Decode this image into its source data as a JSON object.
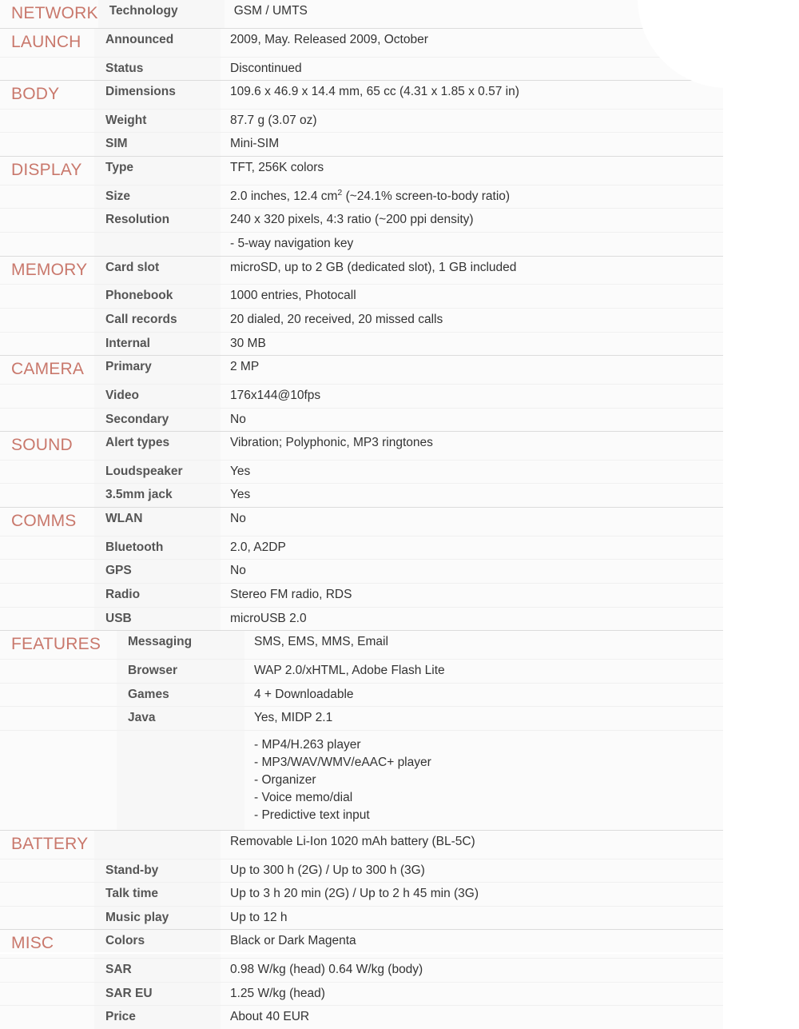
{
  "document": {
    "kind": "phone-specification-table",
    "section_header_color": "#c9786c",
    "label_color": "#555555",
    "value_color": "#333333",
    "row_background": "#fbfbfb",
    "label_background": "#f7f7f7",
    "divider_color": "#f0f0f0",
    "section_divider_color": "#dcdcdc"
  },
  "sections": [
    {
      "name": "NETWORK",
      "rows": [
        {
          "label": "Technology",
          "value": "GSM / UMTS"
        }
      ]
    },
    {
      "name": "LAUNCH",
      "rows": [
        {
          "label": "Announced",
          "value": "2009, May. Released 2009, October"
        },
        {
          "label": "Status",
          "value": "Discontinued"
        }
      ]
    },
    {
      "name": "BODY",
      "rows": [
        {
          "label": "Dimensions",
          "value": "109.6 x 46.9 x 14.4 mm, 65 cc (4.31 x 1.85 x 0.57 in)"
        },
        {
          "label": "Weight",
          "value": "87.7 g (3.07 oz)"
        },
        {
          "label": "SIM",
          "value": "Mini-SIM"
        }
      ]
    },
    {
      "name": "DISPLAY",
      "rows": [
        {
          "label": "Type",
          "value": "TFT, 256K colors"
        },
        {
          "label": "Size",
          "value": "2.0 inches, 12.4 cm2 (~24.1% screen-to-body ratio)",
          "value_html": "2.0 inches, 12.4 cm<sup>2</sup> (~24.1% screen-to-body ratio)"
        },
        {
          "label": "Resolution",
          "value": "240 x 320 pixels, 4:3 ratio (~200 ppi density)"
        },
        {
          "label": "",
          "value": "- 5-way navigation key"
        }
      ]
    },
    {
      "name": "MEMORY",
      "rows": [
        {
          "label": "Card slot",
          "value": "microSD, up to 2 GB (dedicated slot), 1 GB included"
        },
        {
          "label": "Phonebook",
          "value": "1000 entries, Photocall"
        },
        {
          "label": "Call records",
          "value": "20 dialed, 20 received, 20 missed calls"
        },
        {
          "label": "Internal",
          "value": "30 MB"
        }
      ]
    },
    {
      "name": "CAMERA",
      "rows": [
        {
          "label": "Primary",
          "value": "2 MP"
        },
        {
          "label": "Video",
          "value": "176x144@10fps"
        },
        {
          "label": "Secondary",
          "value": "No"
        }
      ]
    },
    {
      "name": "SOUND",
      "rows": [
        {
          "label": "Alert types",
          "value": "Vibration; Polyphonic, MP3 ringtones"
        },
        {
          "label": "Loudspeaker",
          "value": "Yes"
        },
        {
          "label": "3.5mm jack",
          "value": "Yes"
        }
      ]
    },
    {
      "name": "COMMS",
      "rows": [
        {
          "label": "WLAN",
          "value": "No"
        },
        {
          "label": "Bluetooth",
          "value": "2.0, A2DP"
        },
        {
          "label": "GPS",
          "value": "No"
        },
        {
          "label": "Radio",
          "value": "Stereo FM radio, RDS"
        },
        {
          "label": "USB",
          "value": "microUSB 2.0"
        }
      ]
    },
    {
      "name": "FEATURES",
      "wide": true,
      "rows": [
        {
          "label": "Messaging",
          "value": "SMS, EMS, MMS, Email"
        },
        {
          "label": "Browser",
          "value": "WAP 2.0/xHTML, Adobe Flash Lite"
        },
        {
          "label": "Games",
          "value": "4 + Downloadable"
        },
        {
          "label": "Java",
          "value": "Yes, MIDP 2.1"
        },
        {
          "label": "",
          "value": "- MP4/H.263 player\n- MP3/WAV/WMV/eAAC+ player\n- Organizer\n- Voice memo/dial\n- Predictive text input",
          "multiline": true
        }
      ]
    },
    {
      "name": "BATTERY",
      "rows": [
        {
          "label": "",
          "value": "Removable Li-Ion 1020 mAh battery (BL-5C)"
        },
        {
          "label": "Stand-by",
          "value": "Up to 300 h (2G) / Up to 300 h (3G)"
        },
        {
          "label": "Talk time",
          "value": "Up to 3 h 20 min (2G) / Up to 2 h 45 min (3G)"
        },
        {
          "label": "Music play",
          "value": "Up to 12 h"
        }
      ]
    },
    {
      "name": "MISC",
      "rows": [
        {
          "label": "Colors",
          "value": "Black or Dark Magenta"
        },
        {
          "label": "SAR",
          "value": "0.98 W/kg (head)    0.64 W/kg (body)"
        },
        {
          "label": "SAR EU",
          "value": "1.25 W/kg (head)"
        },
        {
          "label": "Price",
          "value": "About 40 EUR"
        }
      ]
    }
  ]
}
